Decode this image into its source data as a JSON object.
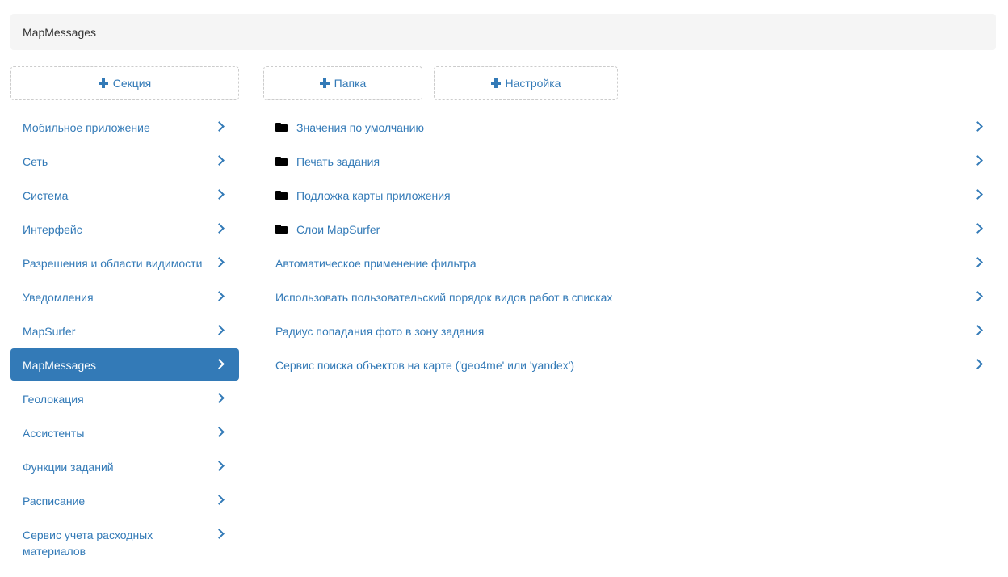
{
  "breadcrumb": {
    "current": "MapMessages"
  },
  "toolbar": {
    "add_section_label": "Секция",
    "add_folder_label": "Папка",
    "add_setting_label": "Настройка"
  },
  "colors": {
    "accent": "#337ab7",
    "breadcrumb_bg": "#f5f5f5",
    "folder_icon": "#000000"
  },
  "sections": {
    "items": [
      {
        "label": "Мобильное приложение",
        "active": false
      },
      {
        "label": "Сеть",
        "active": false
      },
      {
        "label": "Система",
        "active": false
      },
      {
        "label": "Интерфейс",
        "active": false
      },
      {
        "label": "Разрешения и области видимости",
        "active": false
      },
      {
        "label": "Уведомления",
        "active": false
      },
      {
        "label": "MapSurfer",
        "active": false
      },
      {
        "label": "MapMessages",
        "active": true
      },
      {
        "label": "Геолокация",
        "active": false
      },
      {
        "label": "Ассистенты",
        "active": false
      },
      {
        "label": "Функции заданий",
        "active": false
      },
      {
        "label": "Расписание",
        "active": false
      },
      {
        "label": "Сервис учета расходных материалов",
        "active": false
      }
    ]
  },
  "content": {
    "items": [
      {
        "label": "Значения по умолчанию",
        "type": "folder",
        "icon": "folder-icon"
      },
      {
        "label": "Печать задания",
        "type": "folder",
        "icon": "folder-icon"
      },
      {
        "label": "Подложка карты приложения",
        "type": "folder",
        "icon": "folder-icon"
      },
      {
        "label": "Слои MapSurfer",
        "type": "folder",
        "icon": "folder-icon"
      },
      {
        "label": "Автоматическое применение фильтра",
        "type": "setting"
      },
      {
        "label": "Использовать пользовательский порядок видов работ в списках",
        "type": "setting"
      },
      {
        "label": "Радиус попадания фото в зону задания",
        "type": "setting"
      },
      {
        "label": "Сервис поиска объектов на карте ('geo4me' или 'yandex')",
        "type": "setting"
      }
    ]
  }
}
